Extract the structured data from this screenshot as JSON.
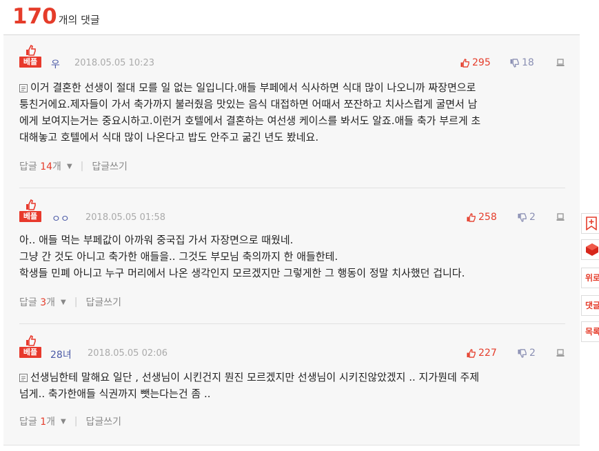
{
  "header": {
    "count": "170",
    "label": "개의 댓글"
  },
  "comments": [
    {
      "badge": "베플",
      "author": "우",
      "date": "2018.05.05 10:23",
      "likes": "295",
      "dislikes": "18",
      "lines": [
        "이거 결혼한 선생이 절대 모를 일 없는 일입니다.애들 부페에서 식사하면 식대 많이 나오니까 짜장면으로",
        "퉁친거에요.제자들이 가서 축가까지 불러줬음 맛있는 음식 대접하면 어때서 쪼잔하고 치사스럽게 굴면서 남",
        "에게 보여지는거는 중요시하고.이런거 호텔에서 결혼하는 여선생 케이스를 봐서도 알죠.애들 축가 부르게 초",
        "대해놓고 호텔에서 식대 많이 나온다고 밥도 안주고 굶긴 년도 봤네요."
      ],
      "has_doc_icon": true,
      "reply_label": "답글",
      "reply_count": "14",
      "reply_unit": "개",
      "write_reply": "답글쓰기"
    },
    {
      "badge": "베플",
      "author": "ㅇㅇ",
      "date": "2018.05.05 01:58",
      "likes": "258",
      "dislikes": "2",
      "lines": [
        "아.. 애들 먹는 부페값이 아까워 중국집 가서 자장면으로 때웠네.",
        "그냥 간 것도 아니고 축가한 애들을.. 그것도 부모님 축의까지 한 애들한테.",
        "학생들 민폐 아니고 누구 머리에서 나온 생각인지 모르겠지만 그렇게한 그 행동이 정말 치사했던 겁니다."
      ],
      "has_doc_icon": false,
      "reply_label": "답글",
      "reply_count": "3",
      "reply_unit": "개",
      "write_reply": "답글쓰기"
    },
    {
      "badge": "베플",
      "author": "28녀",
      "date": "2018.05.05 02:06",
      "likes": "227",
      "dislikes": "2",
      "lines": [
        "선생님한테 말해요 일단 , 선생님이 시킨건지 뭔진 모르겠지만 선생님이 시키진않았겠지 .. 지가뭔데 주제",
        "넘게.. 축가한애들 식권까지 뺏는다는건 좀 .."
      ],
      "has_doc_icon": true,
      "reply_label": "답글",
      "reply_count": "1",
      "reply_unit": "개",
      "write_reply": "답글쓰기"
    }
  ],
  "side_tools": [
    {
      "icon": "bookmark-plus-icon",
      "label": ""
    },
    {
      "icon": "cube-icon",
      "label": ""
    },
    {
      "icon": "up-label",
      "label": "위로"
    },
    {
      "icon": "comment-label",
      "label": "댓글"
    },
    {
      "icon": "list-label",
      "label": "목록"
    }
  ]
}
